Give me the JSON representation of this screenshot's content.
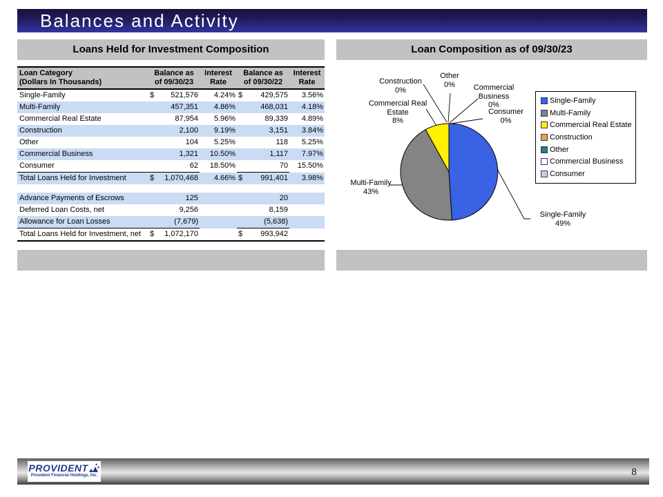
{
  "slide": {
    "title": "Balances and Activity",
    "page_number": "8",
    "logo": {
      "name": "PROVIDENT",
      "tagline": "Provident Financial Holdings, Inc."
    }
  },
  "left_panel": {
    "header": "Loans Held for Investment Composition",
    "table": {
      "header": {
        "category": "Loan Category\n(Dollars In Thousands)",
        "balance1": "Balance as\nof 09/30/23",
        "rate1": "Interest\nRate",
        "balance2": "Balance as\nof 09/30/22",
        "rate2": "Interest\nRate"
      },
      "rows": [
        {
          "label": "Single-Family",
          "d1": "$",
          "v1": "521,576",
          "r1": "4.24%",
          "d2": "$",
          "v2": "429,575",
          "r2": "3.56%"
        },
        {
          "label": "Multi-Family",
          "v1": "457,351",
          "r1": "4.86%",
          "v2": "468,031",
          "r2": "4.18%",
          "band": true
        },
        {
          "label": "Commercial Real Estate",
          "v1": "87,954",
          "r1": "5.96%",
          "v2": "89,339",
          "r2": "4.89%"
        },
        {
          "label": "Construction",
          "v1": "2,100",
          "r1": "9.19%",
          "v2": "3,151",
          "r2": "3.84%",
          "band": true
        },
        {
          "label": "Other",
          "v1": "104",
          "r1": "5.25%",
          "v2": "118",
          "r2": "5.25%"
        },
        {
          "label": "Commercial Business",
          "v1": "1,321",
          "r1": "10.50%",
          "v2": "1,117",
          "r2": "7.97%",
          "band": true
        },
        {
          "label": "Consumer",
          "v1": "62",
          "r1": "18.50%",
          "v2": "70",
          "r2": "15.50%",
          "underline": true
        },
        {
          "label": "Total Loans Held for Investment",
          "d1": "$",
          "v1": "1,070,468",
          "r1": "4.66%",
          "d2": "$",
          "v2": "991,401",
          "r2": "3.98%",
          "band": true
        },
        {
          "spacer": true
        },
        {
          "label": "Advance Payments of Escrows",
          "v1": "125",
          "v2": "20",
          "band": true
        },
        {
          "label": "Deferred Loan Costs, net",
          "v1": "9,256",
          "v2": "8,159"
        },
        {
          "label": "Allowance for Loan Losses",
          "v1": "(7,679)",
          "v2": "(5,638)",
          "band": true,
          "underline": true
        },
        {
          "label": "Total Loans Held for Investment, net",
          "d1": "$",
          "v1": "1,072,170",
          "d2": "$",
          "v2": "993,942",
          "total": true
        }
      ]
    }
  },
  "right_panel": {
    "header": "Loan Composition as of 09/30/23"
  },
  "chart_data": {
    "type": "pie",
    "title": "Loan Composition as of 09/30/23",
    "legend_position": "right",
    "slices": [
      {
        "label": "Single-Family",
        "pct": 49,
        "color": "#3a62e4"
      },
      {
        "label": "Multi-Family",
        "pct": 43,
        "color": "#848484"
      },
      {
        "label": "Commercial Real Estate",
        "pct": 8,
        "color": "#fff100"
      },
      {
        "label": "Construction",
        "pct": 0,
        "color": "#f0a23c"
      },
      {
        "label": "Other",
        "pct": 0,
        "color": "#2a7c80"
      },
      {
        "label": "Commercial Business",
        "pct": 0,
        "color": "#ffffff"
      },
      {
        "label": "Consumer",
        "pct": 0,
        "color": "#c7d0e2"
      }
    ],
    "callouts": {
      "construction": "Construction\n0%",
      "other": "Other\n0%",
      "commercial_business": "Commercial\nBusiness\n0%",
      "consumer": "Consumer\n0%",
      "commercial_real_estate": "Commercial Real\nEstate\n8%",
      "multi_family": "Multi-Family\n43%",
      "single_family": "Single-Family\n49%"
    }
  }
}
